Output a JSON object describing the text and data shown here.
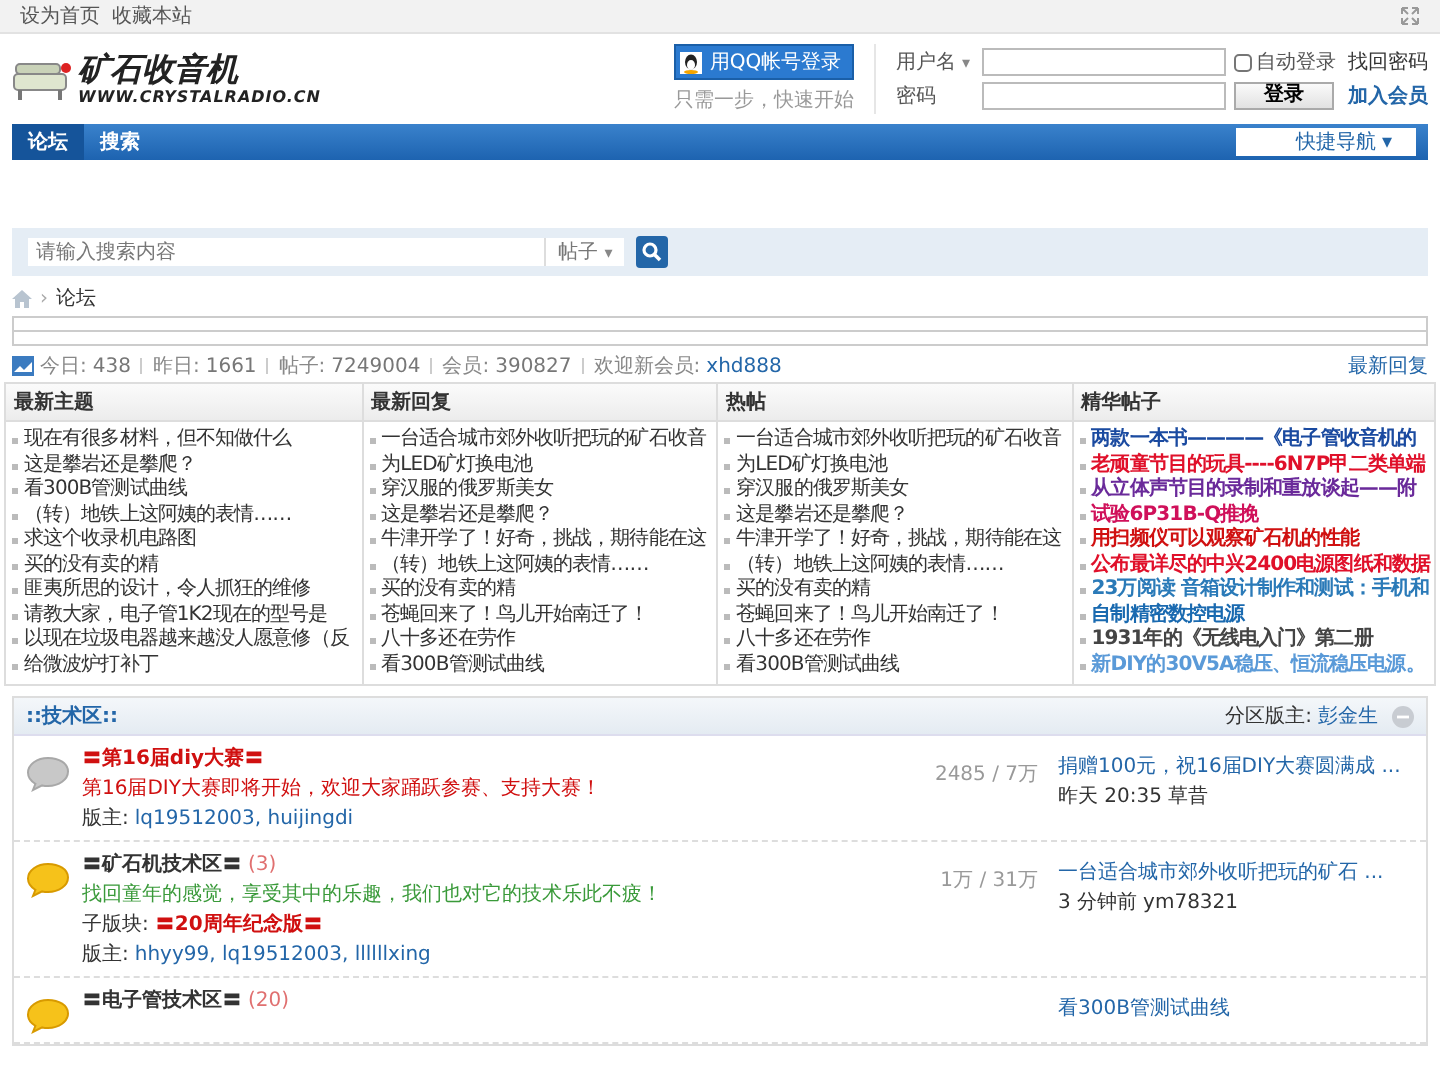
{
  "top_bar": {
    "links": [
      "设为首页",
      "收藏本站"
    ]
  },
  "logo": {
    "title": "矿石收音机",
    "url": "WWW.CRYSTALRADIO.CN"
  },
  "qq_login": {
    "button": "用QQ帐号登录",
    "hint": "只需一步，快速开始"
  },
  "login": {
    "username_label": "用户名",
    "username_caret": "▾",
    "password_label": "密码",
    "auto_login": {
      "label": "自动登录",
      "checked": false
    },
    "forgot": "找回密码",
    "submit": "登录",
    "register": "加入会员"
  },
  "nav": {
    "tabs": [
      {
        "label": "论坛",
        "selected": true
      },
      {
        "label": "搜索",
        "selected": false
      }
    ],
    "quick_nav": "快捷导航",
    "quick_nav_caret": "▾"
  },
  "search": {
    "placeholder": "请输入搜索内容",
    "scope": "帖子",
    "scope_caret": "▾"
  },
  "breadcrumb_separator": "›",
  "breadcrumb": [
    "论坛"
  ],
  "stats": [
    {
      "label": "今日:",
      "value": "438"
    },
    {
      "label": "昨日:",
      "value": "1661"
    },
    {
      "label": "帖子:",
      "value": "7249004"
    },
    {
      "label": "会员:",
      "value": "390827"
    },
    {
      "label": "欢迎新会员:",
      "value": "xhd888",
      "kind": "link"
    }
  ],
  "latest_reply_link": "最新回复",
  "columns": [
    {
      "title": "最新主题",
      "items": [
        {
          "text": "现在有很多材料，但不知做什么"
        },
        {
          "text": "这是攀岩还是攀爬？"
        },
        {
          "text": "看300B管测试曲线"
        },
        {
          "text": "（转）地铁上这阿姨的表情……"
        },
        {
          "text": "求这个收录机电路图"
        },
        {
          "text": "买的没有卖的精"
        },
        {
          "text": "匪夷所思的设计，令人抓狂的维修"
        },
        {
          "text": "请教大家，电子管1K2现在的型号是"
        },
        {
          "text": "以现在垃圾电器越来越没人愿意修（反"
        },
        {
          "text": "给微波炉打补丁"
        }
      ]
    },
    {
      "title": "最新回复",
      "items": [
        {
          "text": "一台适合城市郊外收听把玩的矿石收音"
        },
        {
          "text": "为LED矿灯换电池"
        },
        {
          "text": "穿汉服的俄罗斯美女"
        },
        {
          "text": "这是攀岩还是攀爬？"
        },
        {
          "text": "牛津开学了！好奇，挑战，期待能在这"
        },
        {
          "text": "（转）地铁上这阿姨的表情……"
        },
        {
          "text": "买的没有卖的精"
        },
        {
          "text": "苍蝇回来了！鸟儿开始南迁了！"
        },
        {
          "text": "八十多还在劳作"
        },
        {
          "text": "看300B管测试曲线"
        }
      ]
    },
    {
      "title": "热帖",
      "items": [
        {
          "text": "一台适合城市郊外收听把玩的矿石收音"
        },
        {
          "text": "为LED矿灯换电池"
        },
        {
          "text": "穿汉服的俄罗斯美女"
        },
        {
          "text": "这是攀岩还是攀爬？"
        },
        {
          "text": "牛津开学了！好奇，挑战，期待能在这"
        },
        {
          "text": "（转）地铁上这阿姨的表情……"
        },
        {
          "text": "买的没有卖的精"
        },
        {
          "text": "苍蝇回来了！鸟儿开始南迁了！"
        },
        {
          "text": "八十多还在劳作"
        },
        {
          "text": "看300B管测试曲线"
        }
      ]
    },
    {
      "title": "精华帖子",
      "items": [
        {
          "text": "两款一本书————《电子管收音机的",
          "color": "#1a4aa0"
        },
        {
          "text": "老顽童节目的玩具----6N7P甲二类单端",
          "color": "#e0102a"
        },
        {
          "text": "从立体声节目的录制和重放谈起——附",
          "color": "#6a2a9a"
        },
        {
          "text": "试验6P31B-Q推挽",
          "color": "#d0105a"
        },
        {
          "text": "用扫频仪可以观察矿石机的性能",
          "color": "#d01010"
        },
        {
          "text": "公布最详尽的中兴2400电源图纸和数据",
          "color": "#e0102a"
        },
        {
          "text": "23万阅读 音箱设计制作和测试：手机和",
          "color": "#2a7ab8"
        },
        {
          "text": "自制精密数控电源",
          "color": "#1a6ab0"
        },
        {
          "text": "1931年的《无线电入门》第二册",
          "color": "#444444"
        },
        {
          "text": "新DIY的30V5A稳压、恒流稳压电源。",
          "color": "#5a9ad8"
        }
      ]
    }
  ],
  "section": {
    "title": "::技术区::",
    "moderator_label": "分区版主:",
    "moderator": "彭金生",
    "forums": [
      {
        "title": {
          "text": "〓第16届diy大赛〓",
          "color": "#d01010"
        },
        "has_new": false,
        "description": {
          "text": "第16届DIY大赛即将开始，欢迎大家踊跃参赛、支持大赛！",
          "color": "#d01010"
        },
        "moderators_label": "版主:",
        "moderators": "lq19512003, huijingdi",
        "counts": "2485 / 7万",
        "last_post": "捐赠100元，祝16届DIY大赛圆满成 ...",
        "last_time": "昨天 20:35",
        "last_user": "草昔"
      },
      {
        "title": {
          "text": "〓矿石机技术区〓",
          "color": "#333333"
        },
        "today": "(3)",
        "has_new": true,
        "description": {
          "text": "找回童年的感觉，享受其中的乐趣，我们也对它的技术乐此不疲！",
          "color": "#3a9a3a"
        },
        "subforums_label": "子版块:",
        "subforums": [
          "〓20周年纪念版〓"
        ],
        "moderators_label": "版主:",
        "moderators": "hhyy99, lq19512003, llllllxing",
        "counts": "1万 / 31万",
        "last_post": "一台适合城市郊外收听把玩的矿石 ...",
        "last_time": "3 分钟前",
        "last_user": "ym78321"
      },
      {
        "title": {
          "text": "〓电子管技术区〓",
          "color": "#333333"
        },
        "today": "(20)",
        "has_new": true,
        "last_post": "看300B管测试曲线"
      }
    ]
  }
}
